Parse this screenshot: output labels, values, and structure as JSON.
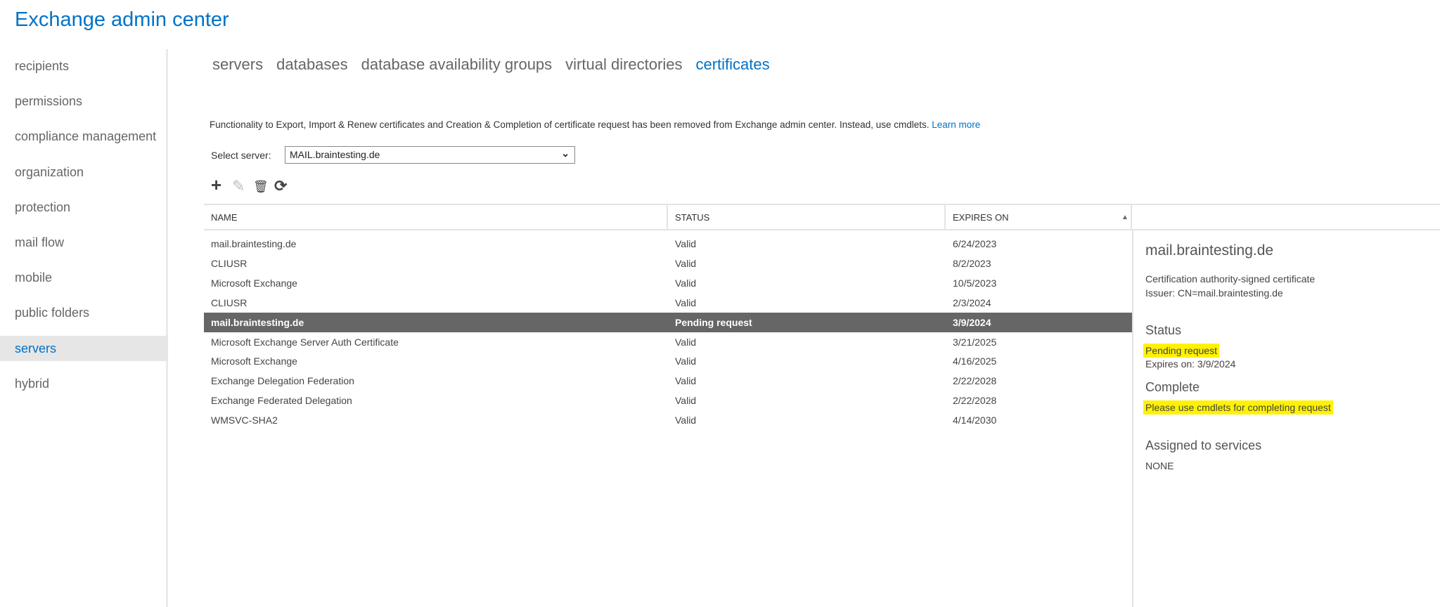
{
  "app_title": "Exchange admin center",
  "sidebar": {
    "items": [
      {
        "label": "recipients"
      },
      {
        "label": "permissions"
      },
      {
        "label": "compliance management"
      },
      {
        "label": "organization"
      },
      {
        "label": "protection"
      },
      {
        "label": "mail flow"
      },
      {
        "label": "mobile"
      },
      {
        "label": "public folders"
      },
      {
        "label": "servers",
        "selected": true
      },
      {
        "label": "hybrid"
      }
    ]
  },
  "tabs": [
    {
      "label": "servers"
    },
    {
      "label": "databases"
    },
    {
      "label": "database availability groups"
    },
    {
      "label": "virtual directories"
    },
    {
      "label": "certificates",
      "selected": true
    }
  ],
  "notice": {
    "text": "Functionality to Export, Import & Renew certificates and Creation & Completion of certificate request has been removed from Exchange admin center. Instead, use cmdlets. ",
    "link": "Learn more"
  },
  "server_select": {
    "label": "Select server:",
    "value": "MAIL.braintesting.de"
  },
  "toolbar": {
    "add": "+",
    "edit": "✎",
    "delete": "🗑",
    "refresh": "⟳"
  },
  "table": {
    "headers": {
      "name": "NAME",
      "status": "STATUS",
      "expires": "EXPIRES ON",
      "sort_indicator": "▲"
    },
    "rows": [
      {
        "name": "mail.braintesting.de",
        "status": "Valid",
        "expires": "6/24/2023"
      },
      {
        "name": "CLIUSR",
        "status": "Valid",
        "expires": "8/2/2023"
      },
      {
        "name": "Microsoft Exchange",
        "status": "Valid",
        "expires": "10/5/2023"
      },
      {
        "name": "CLIUSR",
        "status": "Valid",
        "expires": "2/3/2024"
      },
      {
        "name": "mail.braintesting.de",
        "status": "Pending request",
        "expires": "3/9/2024",
        "selected": true
      },
      {
        "name": "Microsoft Exchange Server Auth Certificate",
        "status": "Valid",
        "expires": "3/21/2025"
      },
      {
        "name": "Microsoft Exchange",
        "status": "Valid",
        "expires": "4/16/2025"
      },
      {
        "name": "Exchange Delegation Federation",
        "status": "Valid",
        "expires": "2/22/2028"
      },
      {
        "name": "Exchange Federated Delegation",
        "status": "Valid",
        "expires": "2/22/2028"
      },
      {
        "name": "WMSVC-SHA2",
        "status": "Valid",
        "expires": "4/14/2030"
      }
    ]
  },
  "details": {
    "title": "mail.braintesting.de",
    "type": "Certification authority-signed certificate",
    "issuer": "Issuer: CN=mail.braintesting.de",
    "status_heading": "Status",
    "status": "Pending request",
    "expires": "Expires on: 3/9/2024",
    "complete_heading": "Complete",
    "complete_text": "Please use cmdlets for completing request",
    "services_heading": "Assigned to services",
    "services": "NONE"
  }
}
